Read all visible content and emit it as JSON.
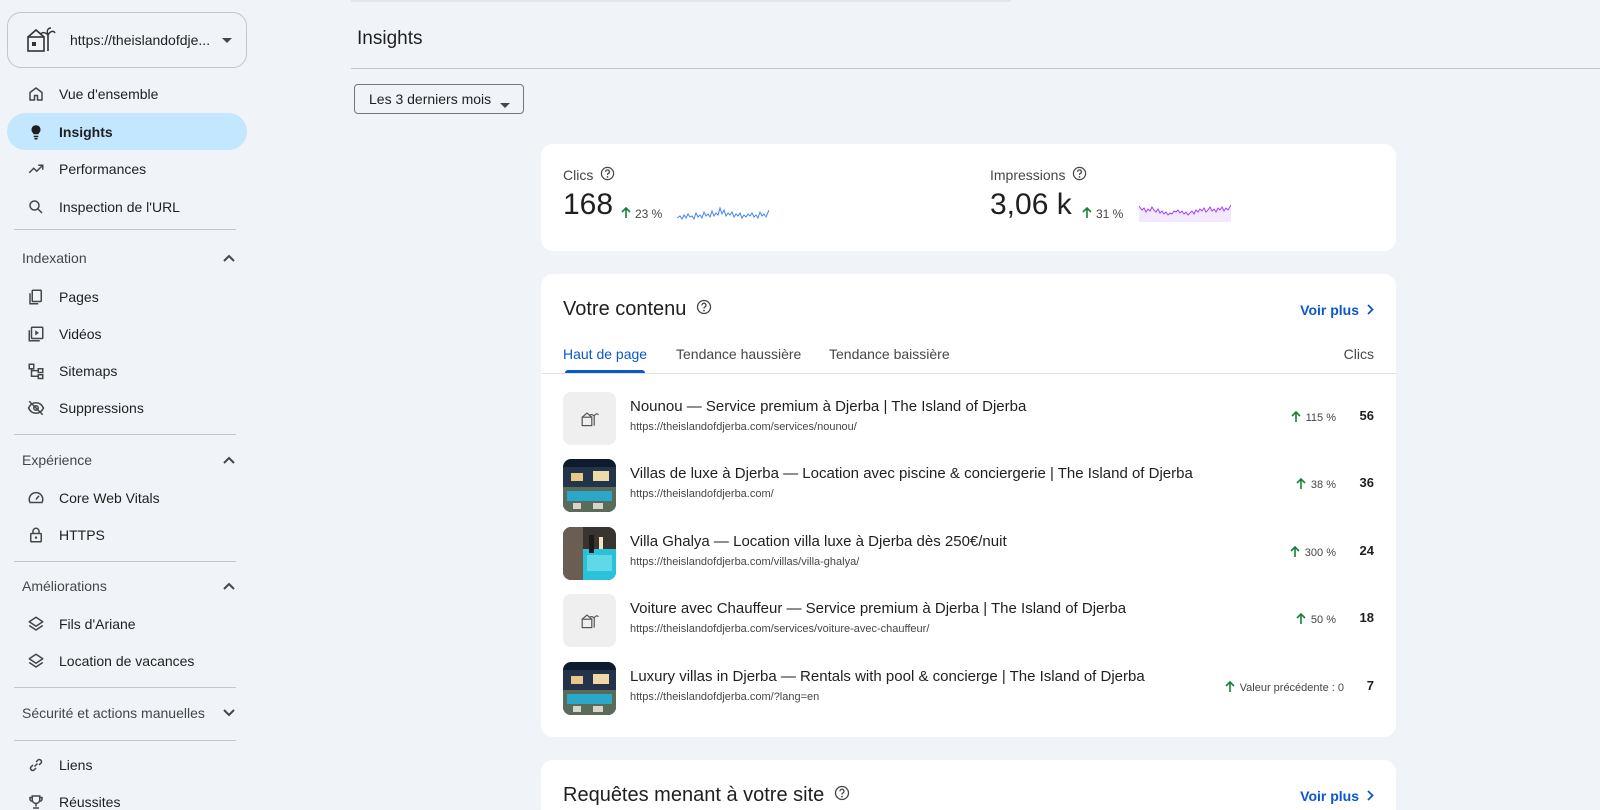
{
  "property": {
    "url": "https://theislandofdje..."
  },
  "sidebar": {
    "top_items": [
      {
        "label": "Vue d'ensemble",
        "icon": "home-icon"
      },
      {
        "label": "Insights",
        "icon": "lightbulb-icon",
        "active": true
      },
      {
        "label": "Performances",
        "icon": "trending-up-icon"
      },
      {
        "label": "Inspection de l'URL",
        "icon": "search-icon"
      }
    ],
    "sections": [
      {
        "label": "Indexation",
        "expanded": true,
        "items": [
          {
            "label": "Pages",
            "icon": "pages-icon"
          },
          {
            "label": "Vidéos",
            "icon": "video-icon"
          },
          {
            "label": "Sitemaps",
            "icon": "sitemap-icon"
          },
          {
            "label": "Suppressions",
            "icon": "visibility-off-icon"
          }
        ]
      },
      {
        "label": "Expérience",
        "expanded": true,
        "items": [
          {
            "label": "Core Web Vitals",
            "icon": "speed-gauge-icon"
          },
          {
            "label": "HTTPS",
            "icon": "lock-icon"
          }
        ]
      },
      {
        "label": "Améliorations",
        "expanded": true,
        "items": [
          {
            "label": "Fils d'Ariane",
            "icon": "layers-icon"
          },
          {
            "label": "Location de vacances",
            "icon": "layers-icon"
          }
        ]
      },
      {
        "label": "Sécurité et actions manuelles",
        "expanded": false,
        "items": []
      }
    ],
    "bottom_items": [
      {
        "label": "Liens",
        "icon": "link-icon"
      },
      {
        "label": "Réussites",
        "icon": "trophy-icon"
      }
    ]
  },
  "header": {
    "title": "Insights"
  },
  "date_range": {
    "selected": "Les 3 derniers mois"
  },
  "metrics": {
    "clicks": {
      "label": "Clics",
      "value": "168",
      "change": "23 %",
      "color": "#4285f4"
    },
    "impressions": {
      "label": "Impressions",
      "value": "3,06 k",
      "change": "31 %",
      "color": "#a142f4"
    }
  },
  "content": {
    "title": "Votre contenu",
    "see_more": "Voir plus",
    "tabs": [
      "Haut de page",
      "Tendance haussière",
      "Tendance baissière"
    ],
    "column_header": "Clics",
    "rows": [
      {
        "title": "Nounou — Service premium à Djerba | The Island of Djerba",
        "url": "https://theislandofdjerba.com/services/nounou/",
        "change": "115 %",
        "clicks": "56",
        "thumb": "logo"
      },
      {
        "title": "Villas de luxe à Djerba — Location avec piscine & conciergerie | The Island of Djerba",
        "url": "https://theislandofdjerba.com/",
        "change": "38 %",
        "clicks": "36",
        "thumb": "villa-night"
      },
      {
        "title": "Villa Ghalya — Location villa luxe à Djerba dès 250€/nuit",
        "url": "https://theislandofdjerba.com/villas/villa-ghalya/",
        "change": "300 %",
        "clicks": "24",
        "thumb": "pool"
      },
      {
        "title": "Voiture avec Chauffeur — Service premium à Djerba | The Island of Djerba",
        "url": "https://theislandofdjerba.com/services/voiture-avec-chauffeur/",
        "change": "50 %",
        "clicks": "18",
        "thumb": "logo"
      },
      {
        "title": "Luxury villas in Djerba — Rentals with pool & concierge | The Island of Djerba",
        "url": "https://theislandofdjerba.com/?lang=en",
        "change": "Valeur précédente : 0",
        "clicks": "7",
        "thumb": "villa-night"
      }
    ]
  },
  "queries": {
    "title": "Requêtes menant à votre site",
    "see_more": "Voir plus"
  },
  "colors": {
    "accent": "#0b57d0",
    "active_nav": "#c2e7ff",
    "up_arrow": "#188038",
    "background": "#f0f4f9"
  }
}
